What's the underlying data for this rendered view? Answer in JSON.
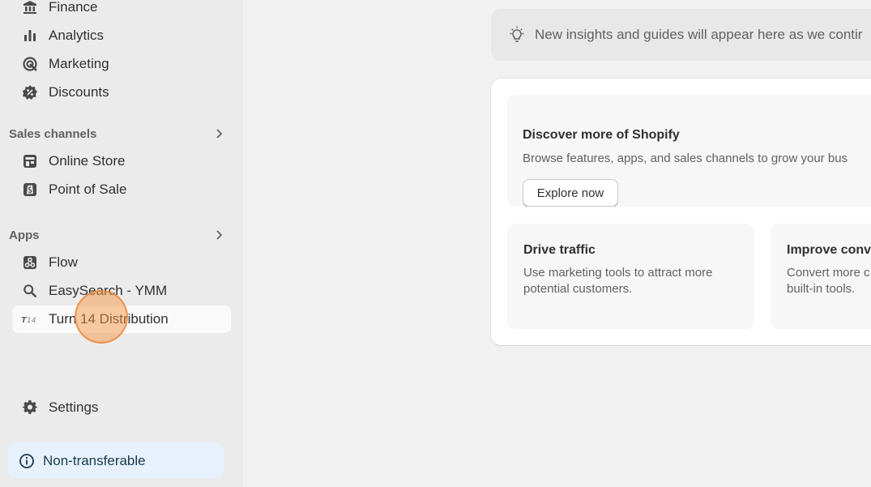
{
  "sidebar": {
    "items": [
      {
        "label": "Finance",
        "icon": "bank-icon"
      },
      {
        "label": "Analytics",
        "icon": "bar-chart-icon"
      },
      {
        "label": "Marketing",
        "icon": "target-icon"
      },
      {
        "label": "Discounts",
        "icon": "discount-icon"
      }
    ],
    "sales_channels": {
      "title": "Sales channels",
      "items": [
        {
          "label": "Online Store",
          "icon": "store-icon"
        },
        {
          "label": "Point of Sale",
          "icon": "pos-icon"
        }
      ]
    },
    "apps": {
      "title": "Apps",
      "items": [
        {
          "label": "Flow",
          "icon": "flow-icon"
        },
        {
          "label": "EasySearch - YMM",
          "icon": "search-icon"
        },
        {
          "label": "Turn 14 Distribution",
          "icon": "turn14-logo-icon"
        }
      ]
    },
    "settings": {
      "label": "Settings",
      "icon": "gear-icon"
    },
    "banner": {
      "label": "Non-transferable",
      "icon": "info-icon"
    }
  },
  "main": {
    "insights": {
      "text": "New insights and guides will appear here as we contir",
      "icon": "lightbulb-icon"
    },
    "discover": {
      "title": "Discover more of Shopify",
      "description": "Browse features, apps, and sales channels to grow your bus",
      "button": "Explore now"
    },
    "tiles": [
      {
        "title": "Drive traffic",
        "description": "Use marketing tools to attract more potential customers."
      },
      {
        "title": "Improve conv",
        "description": "Convert more c built-in tools."
      }
    ]
  },
  "colors": {
    "sidebar_bg": "#ebebeb",
    "page_bg": "#f1f1f1",
    "banner_bg": "#e6f1fb",
    "click_marker": "#f59646"
  }
}
